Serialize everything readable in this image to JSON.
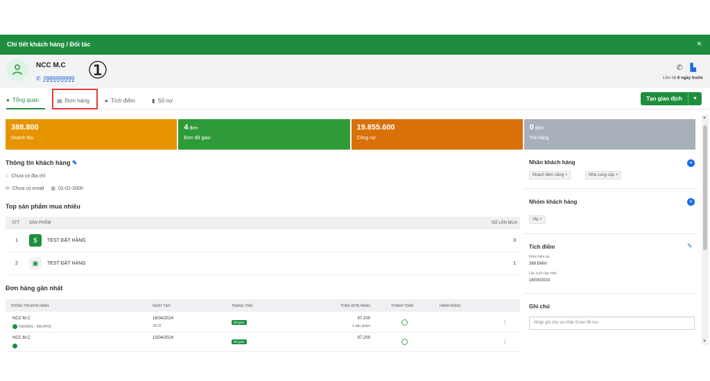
{
  "window": {
    "title": "Chi tiết khách hàng / Đối tác",
    "close": "×"
  },
  "customer": {
    "name": "NCC M.C",
    "phone": "0989999999"
  },
  "header": {
    "contact_prefix": "Liên hệ",
    "contact_time": "6 ngày trước"
  },
  "annotation": {
    "number": "①"
  },
  "tabs": [
    {
      "label": "Tổng quan",
      "icon": "info-icon",
      "active": true
    },
    {
      "label": "Đơn hàng",
      "icon": "document-icon",
      "active": false
    },
    {
      "label": "Tích điểm",
      "icon": "coin-icon",
      "active": false
    },
    {
      "label": "Sổ nợ",
      "icon": "bookmark-icon",
      "active": false
    }
  ],
  "actions": {
    "create_transaction": "Tạo giao dịch"
  },
  "cards": [
    {
      "value": "388.800",
      "unit": "",
      "label": "Doanh thu",
      "color": "#e69500"
    },
    {
      "value": "4",
      "unit": "đơn",
      "label": "Đơn đã giao",
      "color": "#2e9a38"
    },
    {
      "value": "19.855.600",
      "unit": "",
      "label": "Công nợ",
      "color": "#d9700a"
    },
    {
      "value": "0",
      "unit": "đơn",
      "label": "Trả hàng",
      "color": "#a7b0ba"
    }
  ],
  "customer_info": {
    "title": "Thông tin khách hàng",
    "address": "Chưa có địa chỉ",
    "email": "Chưa có email",
    "birthday": "01-01-2000"
  },
  "top_products": {
    "title": "Top sản phẩm mua nhiều",
    "headers": {
      "stt": "STT",
      "product": "SẢN PHẨM",
      "count": "SỐ LẦN MUA"
    },
    "rows": [
      {
        "stt": "1",
        "name": "TEST ĐẶT HÀNG",
        "count": "3",
        "icon": "dollar-icon"
      },
      {
        "stt": "2",
        "name": "TEST ĐẶT HÀNG",
        "count": "1",
        "icon": "image-icon"
      }
    ]
  },
  "recent_orders": {
    "title": "Đơn hàng gần nhất",
    "headers": {
      "info": "THÔNG TIN ĐƠN HÀNG",
      "date": "NGÀY TẠO",
      "status": "TRẠNG THÁI",
      "total": "TỔNG ĐƠN HÀNG",
      "payment": "THANH TOÁN",
      "action": "HÀNH ĐỘNG"
    },
    "rows": [
      {
        "customer": "NCC M.C",
        "code": "HD00001 - KBUHPQ",
        "date": "16/04/2024",
        "time": "18:22",
        "status": "Đã giao",
        "total": "97.200",
        "qty": "1 sản phẩm"
      },
      {
        "customer": "NCC M.C",
        "code": "",
        "date": "15/04/2024",
        "time": "",
        "status": "Đã giao",
        "total": "97.200",
        "qty": ""
      }
    ]
  },
  "right_panel": {
    "labels_title": "Nhãn khách hàng",
    "labels": [
      "Khách tiềm năng",
      "Nhà cung cấp"
    ],
    "group_title": "Nhóm khách hàng",
    "groups": [
      "Vip"
    ],
    "points_title": "Tích điểm",
    "current_points_label": "Điểm hiện tại",
    "current_points": "388 Điểm",
    "last_update_label": "Lần cuối cập nhật",
    "last_update": "16/04/2024",
    "note_title": "Ghi chú",
    "note_placeholder": "Nhập ghi chú và nhấn Enter để lưu"
  }
}
